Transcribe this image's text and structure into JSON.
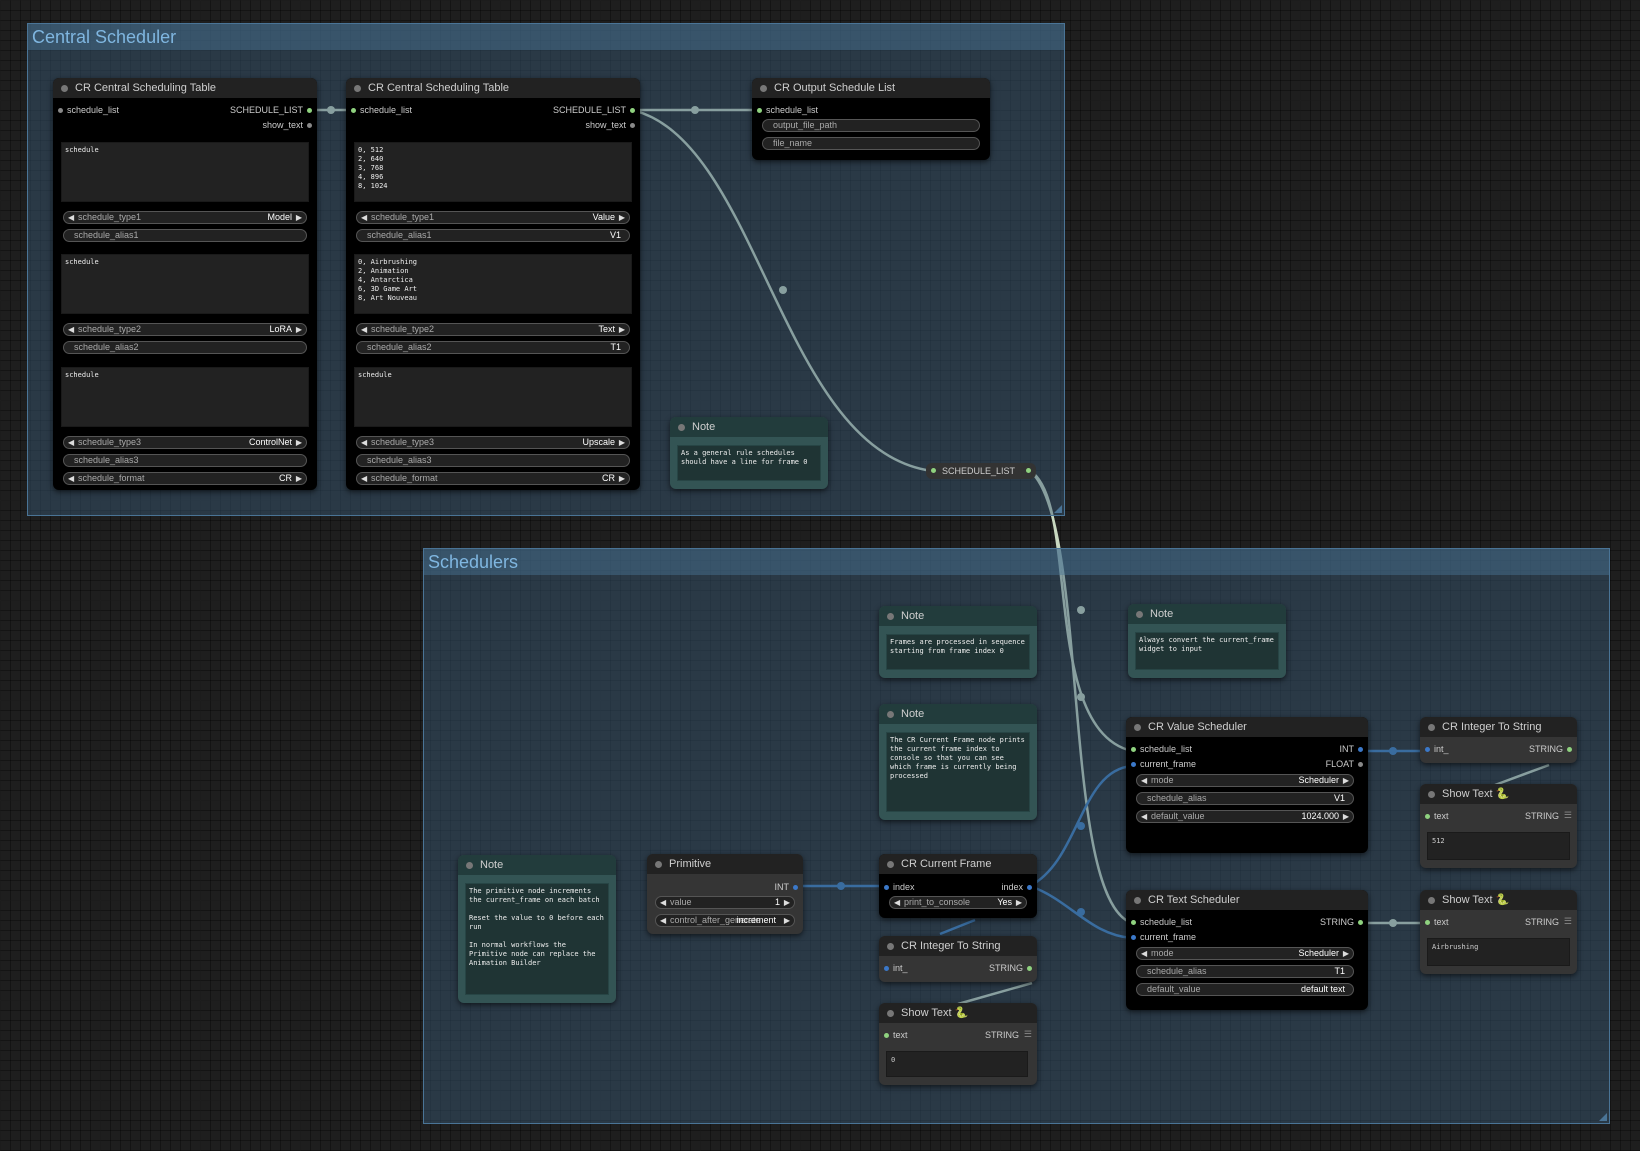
{
  "groups": {
    "central": {
      "title": "Central Scheduler"
    },
    "schedulers": {
      "title": "Schedulers"
    }
  },
  "nodes": {
    "table1": {
      "title": "CR Central Scheduling Table",
      "in_schedule_list": "schedule_list",
      "out_schedule_list": "SCHEDULE_LIST",
      "out_show_text": "show_text",
      "text1": "schedule",
      "type1": {
        "label": "schedule_type1",
        "value": "Model"
      },
      "alias1": {
        "label": "schedule_alias1",
        "value": ""
      },
      "text2": "schedule",
      "type2": {
        "label": "schedule_type2",
        "value": "LoRA"
      },
      "alias2": {
        "label": "schedule_alias2",
        "value": ""
      },
      "text3": "schedule",
      "type3": {
        "label": "schedule_type3",
        "value": "ControlNet"
      },
      "alias3": {
        "label": "schedule_alias3",
        "value": ""
      },
      "format": {
        "label": "schedule_format",
        "value": "CR"
      }
    },
    "table2": {
      "title": "CR Central Scheduling Table",
      "in_schedule_list": "schedule_list",
      "out_schedule_list": "SCHEDULE_LIST",
      "out_show_text": "show_text",
      "text1": "0, 512\n2, 640\n3, 768\n4, 896\n8, 1024",
      "type1": {
        "label": "schedule_type1",
        "value": "Value"
      },
      "alias1": {
        "label": "schedule_alias1",
        "value": "V1"
      },
      "text2": "0, Airbrushing\n2, Animation\n4, Antarctica\n6, 3D Game Art\n8, Art Nouveau",
      "type2": {
        "label": "schedule_type2",
        "value": "Text"
      },
      "alias2": {
        "label": "schedule_alias2",
        "value": "T1"
      },
      "text3": "schedule",
      "type3": {
        "label": "schedule_type3",
        "value": "Upscale"
      },
      "alias3": {
        "label": "schedule_alias3",
        "value": ""
      },
      "format": {
        "label": "schedule_format",
        "value": "CR"
      }
    },
    "output_list": {
      "title": "CR Output Schedule List",
      "in_schedule_list": "schedule_list",
      "output_file_path": "output_file_path",
      "file_name": "file_name"
    },
    "note_central": {
      "title": "Note",
      "text": "As a general rule schedules should have a line for frame 0"
    },
    "reroute": {
      "label": "SCHEDULE_LIST"
    },
    "note_frames": {
      "title": "Note",
      "text": "Frames are processed in sequence starting from frame index 0"
    },
    "note_convert": {
      "title": "Note",
      "text": "Always convert the current_frame widget to input"
    },
    "note_current": {
      "title": "Note",
      "text": "The CR Current Frame node prints the current frame index to console so that you can see which frame is currently being processed"
    },
    "note_primitive": {
      "title": "Note",
      "text": "The primitive node increments the current_frame on each batch\n\nReset the value to 0 before each run\n\nIn normal workflows the Primitive node can replace the Animation Builder"
    },
    "primitive": {
      "title": "Primitive",
      "out_int": "INT",
      "value": {
        "label": "value",
        "value": "1"
      },
      "control": {
        "label": "control_after_generate",
        "value": "increment"
      }
    },
    "current_frame": {
      "title": "CR Current Frame",
      "in_index": "index",
      "out_index": "index",
      "print": {
        "label": "print_to_console",
        "value": "Yes"
      }
    },
    "int_to_string_a": {
      "title": "CR Integer To String",
      "in": "int_",
      "out": "STRING"
    },
    "show_text_a": {
      "title": "Show Text 🐍",
      "in": "text",
      "out": "STRING",
      "value": "0"
    },
    "value_scheduler": {
      "title": "CR Value Scheduler",
      "in_schedule_list": "schedule_list",
      "in_current_frame": "current_frame",
      "out_int": "INT",
      "out_float": "FLOAT",
      "mode": {
        "label": "mode",
        "value": "Scheduler"
      },
      "alias": {
        "label": "schedule_alias",
        "value": "V1"
      },
      "default": {
        "label": "default_value",
        "value": "1024.000"
      }
    },
    "text_scheduler": {
      "title": "CR Text Scheduler",
      "in_schedule_list": "schedule_list",
      "in_current_frame": "current_frame",
      "out_string": "STRING",
      "mode": {
        "label": "mode",
        "value": "Scheduler"
      },
      "alias": {
        "label": "schedule_alias",
        "value": "T1"
      },
      "default": {
        "label": "default_value",
        "value": "default text"
      }
    },
    "int_to_string_b": {
      "title": "CR Integer To String",
      "in": "int_",
      "out": "STRING"
    },
    "show_text_b": {
      "title": "Show Text 🐍",
      "in": "text",
      "out": "STRING",
      "value": "512"
    },
    "show_text_c": {
      "title": "Show Text 🐍",
      "in": "text",
      "out": "STRING",
      "value": "Airbrushing"
    }
  },
  "icons": {
    "arrow_left": "◀",
    "arrow_right": "▶",
    "list_icon": "☰"
  },
  "colors": {
    "link_green": "#c8d8c0",
    "link_blue": "#3a7bc0",
    "group_fill": "#3a5c78"
  }
}
